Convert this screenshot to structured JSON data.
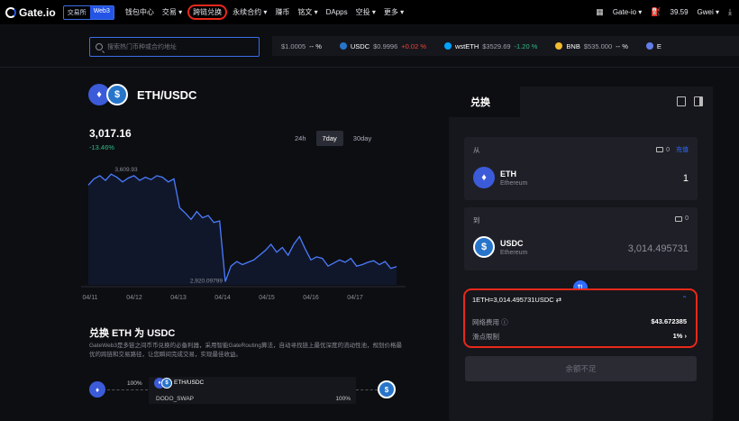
{
  "nav": {
    "brand": "Gate.io",
    "mode_exchange": "交易所",
    "mode_web3": "Web3",
    "menu": [
      "钱包中心",
      "交易 ▾",
      "跨链兑换",
      "永续合约 ▾",
      "赚币",
      "铭文 ▾",
      "DApps",
      "空投 ▾",
      "更多 ▾"
    ],
    "account": "Gate-io ▾",
    "gas_value": "39.59",
    "gas_unit": "Gwei ▾"
  },
  "search": {
    "placeholder": "搜索热门币种或合约地址"
  },
  "tickers": [
    {
      "symbol": "",
      "price": "$1.0005",
      "change": "-- %",
      "color": "#2775ca"
    },
    {
      "symbol": "USDC",
      "price": "$0.9996",
      "change": "+0.02 %",
      "color": "#2775ca"
    },
    {
      "symbol": "wstETH",
      "price": "$3529.69",
      "change": "-1.20 %",
      "color": "#00a3ff"
    },
    {
      "symbol": "BNB",
      "price": "$535.000",
      "change": "-- %",
      "color": "#f3ba2f"
    },
    {
      "symbol": "E",
      "price": "",
      "change": "",
      "color": "#627eea"
    }
  ],
  "pair": {
    "name": "ETH/USDC",
    "price": "3,017.16",
    "change": "-13.46%",
    "ranges": [
      "24h",
      "7day",
      "30day"
    ],
    "active_range": "7day"
  },
  "chart_data": {
    "type": "line",
    "x_labels": [
      "04/11",
      "04/12",
      "04/13",
      "04/14",
      "04/15",
      "04/16",
      "04/17"
    ],
    "high_label": "3,609.93",
    "low_label": "2,920.09799",
    "values": [
      3540,
      3580,
      3600,
      3570,
      3610,
      3590,
      3560,
      3585,
      3600,
      3570,
      3590,
      3575,
      3600,
      3590,
      3560,
      3580,
      3395,
      3360,
      3320,
      3370,
      3330,
      3345,
      3300,
      3310,
      2921,
      3020,
      3050,
      3030,
      3045,
      3060,
      3090,
      3120,
      3160,
      3110,
      3140,
      3090,
      3160,
      3210,
      3130,
      3060,
      3080,
      3070,
      3020,
      3040,
      3060,
      3045,
      3070,
      3020,
      3030,
      3045,
      3055,
      3030,
      3050,
      3005,
      3017
    ]
  },
  "swap_section": {
    "title": "兑换 ETH 为 USDC",
    "description": "GateWeb3是多链之间币币兑换的必备利器，采用智能GateRouting算法，自动寻找链上最优深度的流动性池，规划价格最优的跨链和交易路径，让您瞬间完成交易，实现最佳收益。",
    "route_pct_left": "100%",
    "route_pair": "ETH/USDC",
    "route_dex": "DODO_SWAP",
    "route_pct_right": "100%"
  },
  "panel": {
    "tab": "兑换",
    "from_label": "从",
    "from_balance": "0",
    "deposit": "充值",
    "from_token": "ETH",
    "from_chain": "Ethereum",
    "from_amount": "1",
    "to_label": "到",
    "to_balance": "0",
    "to_token": "USDC",
    "to_chain": "Ethereum",
    "to_amount": "3,014.495731",
    "rate": "1ETH=3,014.495731USDC ⇄",
    "fee_label": "网络费用 ⓘ",
    "fee_value": "$43.672385",
    "slippage_label": "滑点限制",
    "slippage_value": "1% ›",
    "submit": "余额不足"
  }
}
